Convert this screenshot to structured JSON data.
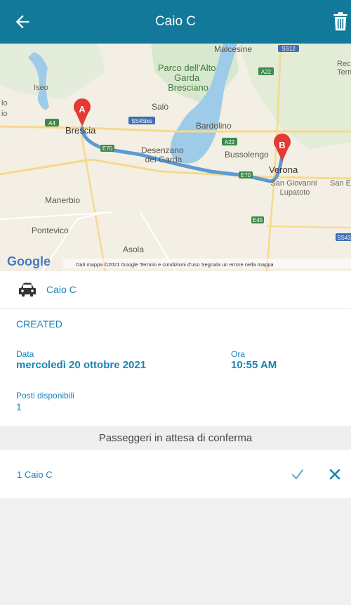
{
  "appbar": {
    "title": "Caio C",
    "back_icon": "arrow-back-icon",
    "delete_icon": "trash-icon",
    "color": "#13799a"
  },
  "map": {
    "labels": {
      "malcesine": "Malcesine",
      "park": "Parco dell'Alto\nGarda\nBresciano",
      "iseo": "Iseo",
      "salo": "Salò",
      "bardolino": "Bardolino",
      "brescia": "Brescia",
      "desenzano": "Desenzano\ndel Garda",
      "bussolengo": "Bussolengo",
      "verona": "Verona",
      "san_giovanni": "San Giovanni\nLupatoto",
      "san_e": "San E",
      "manerbio": "Manerbio",
      "pontevico": "Pontevico",
      "asola": "Asola",
      "recoaro": "Recoa\nTerm",
      "io": "io",
      "lo": "lo"
    },
    "shields": {
      "a22_top": "A22",
      "sp312": "SS12",
      "a4": "A4",
      "ss45bis": "SS45bis",
      "e70_left": "E70",
      "a22_mid": "A22",
      "e70_right": "E70",
      "e45": "E45",
      "ss434": "SS43"
    },
    "marker_a": "A",
    "marker_b": "B",
    "google_logo": "Google",
    "attribution": "Dati mappa ©2021 Google    Termini e condizioni d'uso    Segnala un errore nella mappa",
    "route_color": "#5b9bd5"
  },
  "vehicle": {
    "icon": "car-icon",
    "name": "Caio C"
  },
  "ride": {
    "status": "CREATED",
    "date_label": "Data",
    "date_value": "mercoledì 20 ottobre 2021",
    "time_label": "Ora",
    "time_value": "10:55 AM",
    "seats_label": "Posti disponibili",
    "seats_value": "1"
  },
  "passengers": {
    "header": "Passeggeri in attesa di conferma",
    "items": [
      {
        "label": "1 Caio C",
        "accept_icon": "check-icon",
        "reject_icon": "close-icon"
      }
    ]
  },
  "colors": {
    "accent": "#1a84b4",
    "accept": "#6aa9c9",
    "reject": "#1a84b4"
  }
}
